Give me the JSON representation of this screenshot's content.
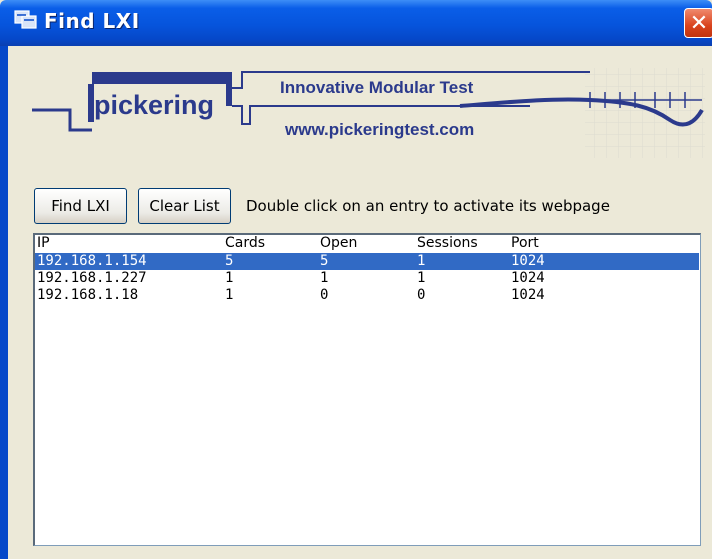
{
  "window": {
    "title": "Find LXI",
    "close_glyph": "✕"
  },
  "logo": {
    "company": "pickering",
    "tagline": "Innovative Modular Test",
    "website": "www.pickeringtest.com"
  },
  "toolbar": {
    "find_label": "Find LXI",
    "clear_label": "Clear List",
    "hint": "Double click on an entry to activate its webpage"
  },
  "list": {
    "columns": [
      "IP",
      "Cards",
      "Open",
      "Sessions",
      "Port"
    ],
    "rows": [
      {
        "ip": "192.168.1.154",
        "cards": "5",
        "open": "5",
        "sessions": "1",
        "port": "1024",
        "selected": true
      },
      {
        "ip": "192.168.1.227",
        "cards": "1",
        "open": "1",
        "sessions": "1",
        "port": "1024",
        "selected": false
      },
      {
        "ip": "192.168.1.18",
        "cards": "1",
        "open": "0",
        "sessions": "0",
        "port": "1024",
        "selected": false
      }
    ]
  },
  "colors": {
    "titlebar": "#0654dc",
    "selection": "#316ac5",
    "brand": "#2b3a8c",
    "face": "#ece9d8"
  },
  "icons": {
    "app": "app-window-icon",
    "close": "close-icon"
  }
}
